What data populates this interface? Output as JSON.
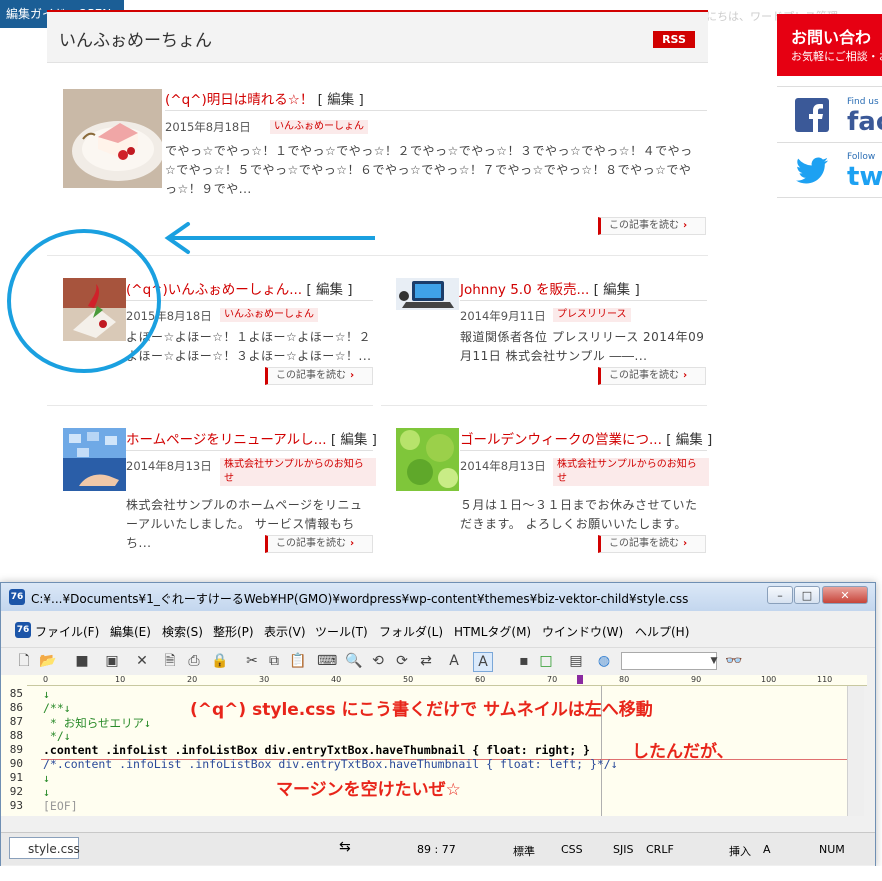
{
  "guide_badge": "編集ガイド：OPEN",
  "greeting": "こんにちは、ワードプレス管理",
  "sidebar": {
    "contact_title": "お問い合わ",
    "contact_sub": "お気軽にご相談・お",
    "facebook_small": "Find us o",
    "facebook_big": "fac",
    "twitter_small": "Follow",
    "twitter_big": "tw"
  },
  "blog": {
    "title": "いんふぉめーちょん",
    "rss_label": "RSS",
    "read_more": "この記事を読む",
    "edit_label": "[ 編集 ]",
    "posts": [
      {
        "title": "(^q^)明日は晴れる☆！",
        "date": "2015年8月18日",
        "category": "いんふぉめーしょん",
        "excerpt": "でやっ☆でやっ☆！１でやっ☆でやっ☆！２でやっ☆でやっ☆！３でやっ☆でやっ☆！４でやっ☆でやっ☆！５でやっ☆でやっ☆！６でやっ☆でやっ☆！７でやっ☆でやっ☆！８でやっ☆でやっ☆！９でや...",
        "thumb_icon": "cake-photo"
      },
      {
        "title": "(^q^)いんふぉめーしょん...",
        "date": "2015年8月18日",
        "category": "いんふぉめーしょん",
        "excerpt": "よほー☆よほー☆！１よほー☆よほー☆！２よほー☆よほー☆！３よほー☆よほー☆！...",
        "thumb_icon": "cake-slice-photo"
      },
      {
        "title": "Johnny 5.0 を販売...",
        "date": "2014年9月11日",
        "category": "プレスリリース",
        "excerpt": "報道関係者各位 プレスリリース 2014年09月11日 株式会社サンプル ――...",
        "thumb_icon": "laptop-photo"
      },
      {
        "title": "ホームページをリニューアルし...",
        "date": "2014年8月13日",
        "category": "株式会社サンプルからのお知らせ",
        "excerpt": "株式会社サンプルのホームページをリニューアルいたしました。 サービス情報もちち...",
        "thumb_icon": "hand-screens-photo"
      },
      {
        "title": "ゴールデンウィークの営業につ...",
        "date": "2014年8月13日",
        "category": "株式会社サンプルからのお知らせ",
        "excerpt": "５月は１日～３１日までお休みさせていただきます。 よろしくお願いいたします。",
        "thumb_icon": "green-leaves-photo"
      }
    ]
  },
  "editor": {
    "title": "C:¥...¥Documents¥1_ぐれーすけーるWeb¥HP(GMO)¥wordpress¥wp-content¥themes¥biz-vektor-child¥style.css",
    "app_icon_text": "76",
    "menu": [
      "ファイル(F)",
      "編集(E)",
      "検索(S)",
      "整形(P)",
      "表示(V)",
      "ツール(T)",
      "フォルダ(L)",
      "HTMLタグ(M)",
      "ウインドウ(W)",
      "ヘルプ(H)"
    ],
    "ruler_marks": [
      "0",
      "10",
      "20",
      "30",
      "40",
      "50",
      "60",
      "70",
      "80",
      "90",
      "100",
      "110"
    ],
    "lines": [
      {
        "num": "85",
        "text": "↓",
        "comment": true
      },
      {
        "num": "86",
        "text": "/**↓",
        "comment": true
      },
      {
        "num": "87",
        "text": " * お知らせエリア↓",
        "comment": true
      },
      {
        "num": "88",
        "text": " */↓",
        "comment": true
      },
      {
        "num": "89",
        "text": ".content .infoList .infoListBox div.entryTxtBox.haveThumbnail { float: right; }",
        "comment": false
      },
      {
        "num": "90",
        "text": "/*.content .infoList .infoListBox div.entryTxtBox.haveThumbnail { float: left; }*/↓",
        "comment": false
      },
      {
        "num": "91",
        "text": "↓",
        "comment": true
      },
      {
        "num": "92",
        "text": "↓",
        "comment": true
      },
      {
        "num": "93",
        "text": "[EOF]",
        "comment": true
      }
    ],
    "file_tab": "style.css",
    "status": {
      "position": "89 : 77",
      "mode": "標準",
      "syntax": "CSS",
      "encoding": "SJIS",
      "newline": "CRLF",
      "insert": "挿入",
      "caps": "A",
      "num": "NUM"
    }
  },
  "annotations": {
    "line1": "(^q^)  style.css にこう書くだけで  サムネイルは左へ移動",
    "line2": "したんだが、",
    "line3": "マージンを空けたいぜ☆"
  },
  "colors": {
    "accent_red": "#d10000",
    "annotation_red": "#e8251a",
    "annotation_blue": "#1aa0e0"
  }
}
